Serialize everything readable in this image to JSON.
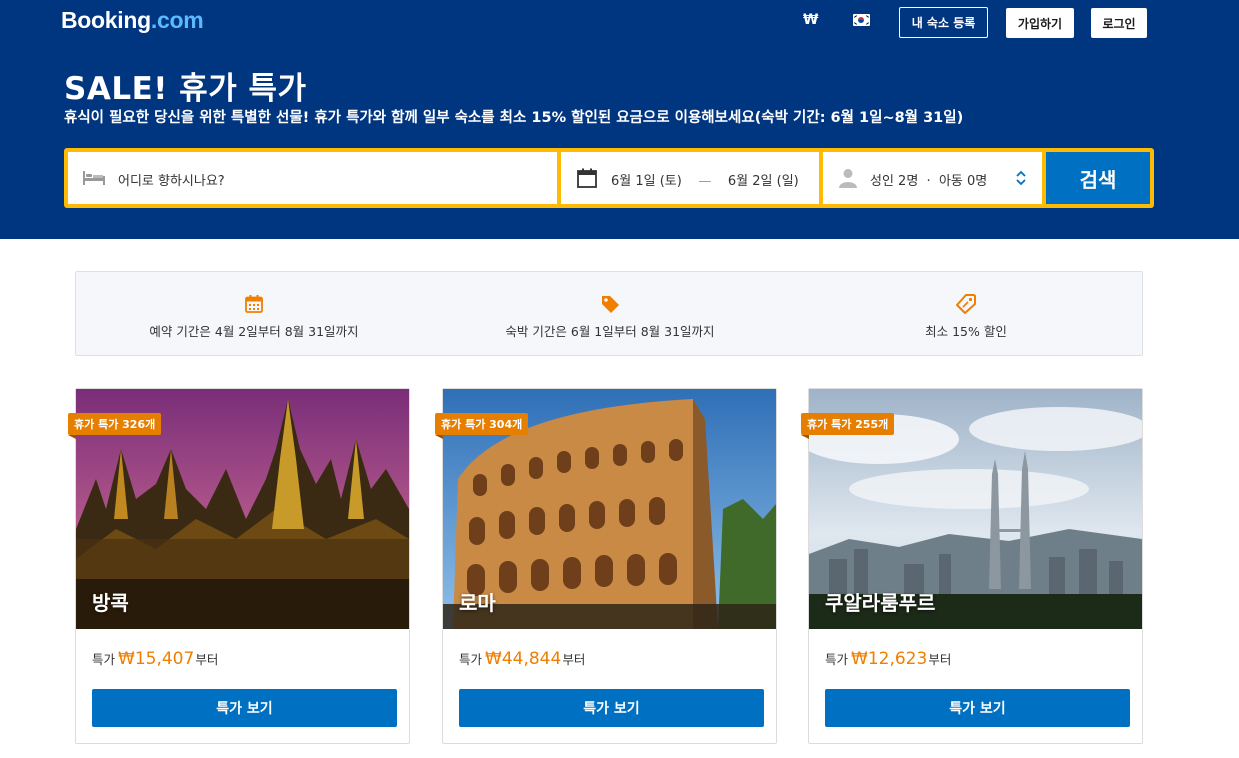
{
  "header": {
    "logo_main": "Booking",
    "logo_suffix": ".com",
    "currency": "₩",
    "flag_icon": "south-korea-flag-icon",
    "list_property_label": "내 숙소 등록",
    "signup_label": "가입하기",
    "login_label": "로그인"
  },
  "hero": {
    "title": "SALE! 휴가 특가",
    "subtitle": "휴식이 필요한 당신을 위한 특별한 선물! 휴가 특가와 함께 일부 숙소를 최소 15% 할인된 요금으로 이용해보세요(숙박 기간: 6월 1일~8월 31일)"
  },
  "search": {
    "destination_placeholder": "어디로 향하시나요?",
    "checkin": "6월 1일 (토)",
    "date_separator": "—",
    "checkout": "6월 2일 (일)",
    "guests": "성인 2명  ·  아동 0명",
    "button_label": "검색"
  },
  "perks": [
    {
      "icon": "calendar-icon",
      "text": "예약 기간은 4월 2일부터 8월 31일까지"
    },
    {
      "icon": "tag-icon",
      "text": "숙박 기간은 6월 1일부터 8월 31일까지"
    },
    {
      "icon": "discount-tag-icon",
      "text": "최소 15% 할인"
    }
  ],
  "cards": [
    {
      "city": "방콕",
      "badge": "휴가 특가 326개",
      "price_prefix": "특가",
      "price": "₩15,407",
      "price_suffix": "부터",
      "button": "특가 보기"
    },
    {
      "city": "로마",
      "badge": "휴가 특가 304개",
      "price_prefix": "특가",
      "price": "₩44,844",
      "price_suffix": "부터",
      "button": "특가 보기"
    },
    {
      "city": "쿠알라룸푸르",
      "badge": "휴가 특가 255개",
      "price_prefix": "특가",
      "price": "₩12,623",
      "price_suffix": "부터",
      "button": "특가 보기"
    }
  ],
  "colors": {
    "header_bg": "#003580",
    "search_border": "#febb02",
    "primary_button": "#0071c2",
    "badge": "#e67e00",
    "price": "#f07f00"
  }
}
